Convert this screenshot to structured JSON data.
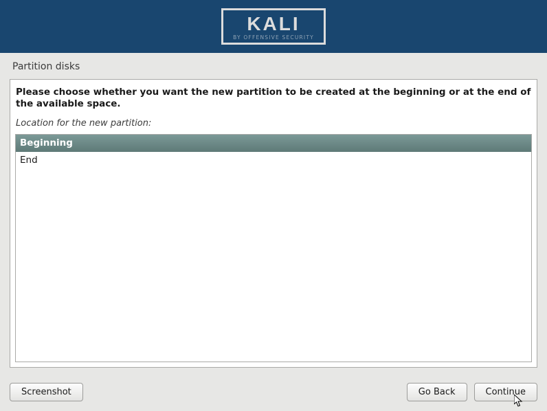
{
  "logo": {
    "title": "KALI",
    "subtitle": "BY OFFENSIVE SECURITY"
  },
  "page": {
    "title": "Partition disks"
  },
  "main": {
    "instruction": "Please choose whether you want the new partition to be created at the beginning or at the end of the available space.",
    "sub_label": "Location for the new partition:",
    "options": {
      "0": "Beginning",
      "1": "End"
    }
  },
  "buttons": {
    "screenshot": "Screenshot",
    "goback": "Go Back",
    "continue": "Continue"
  }
}
